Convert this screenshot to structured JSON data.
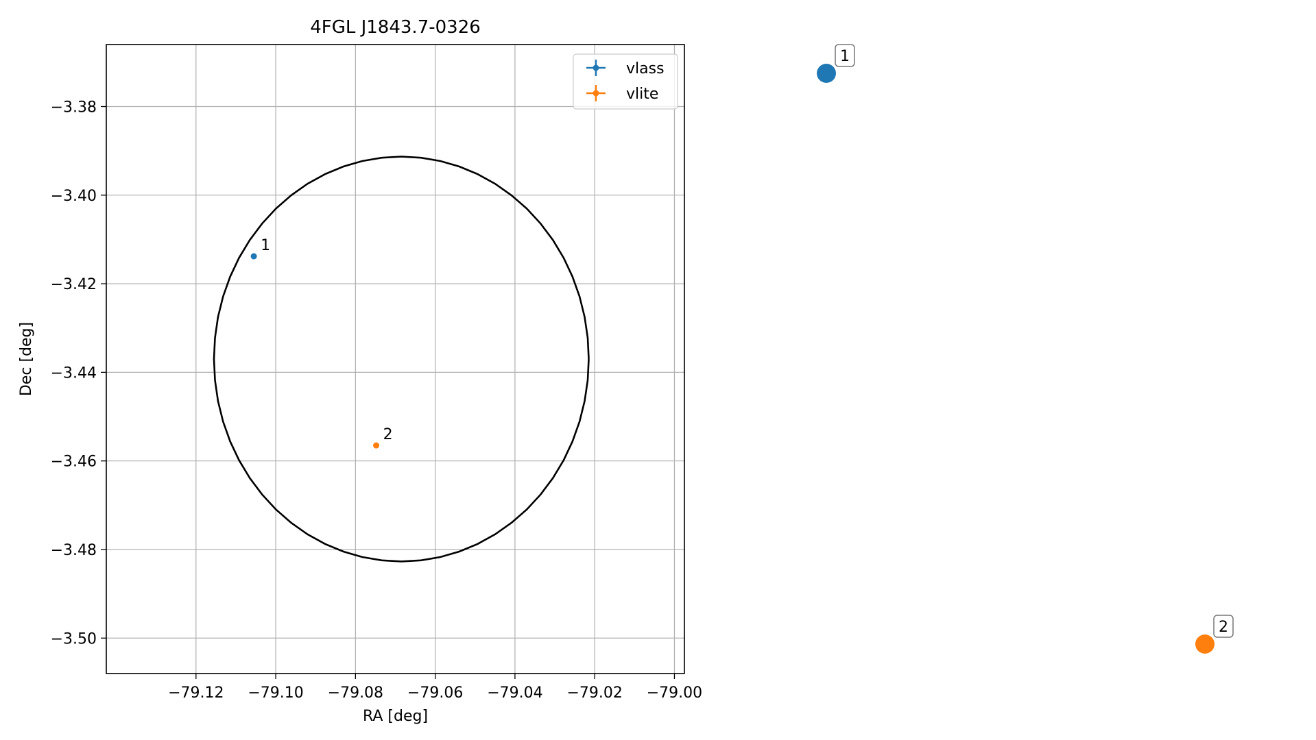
{
  "chart_data": {
    "type": "scatter",
    "title": "4FGL J1843.7-0326",
    "xlabel": "RA [deg]",
    "ylabel": "Dec [deg]",
    "xlim": [
      -79.1425,
      -78.9975
    ],
    "ylim": [
      -3.508,
      -3.366
    ],
    "grid": true,
    "legend_position": "top-right",
    "x_ticks": [
      -79.12,
      -79.1,
      -79.08,
      -79.06,
      -79.04,
      -79.02,
      -79.0
    ],
    "x_tick_labels": [
      "−79.12",
      "−79.10",
      "−79.08",
      "−79.06",
      "−79.04",
      "−79.02",
      "−79.00"
    ],
    "y_ticks": [
      -3.38,
      -3.4,
      -3.42,
      -3.44,
      -3.46,
      -3.48,
      -3.5
    ],
    "y_tick_labels": [
      "−3.38",
      "−3.40",
      "−3.42",
      "−3.44",
      "−3.46",
      "−3.48",
      "−3.50"
    ],
    "series": [
      {
        "name": "vlass",
        "color": "#1f77b4",
        "points": [
          {
            "x": -79.1055,
            "y": -3.4138,
            "label": "1"
          }
        ]
      },
      {
        "name": "vlite",
        "color": "#ff7f0e",
        "points": [
          {
            "x": -79.0748,
            "y": -3.4565,
            "label": "2"
          }
        ]
      }
    ],
    "circle": {
      "center_x": -79.0685,
      "center_y": -3.437,
      "radius_x": 0.047,
      "radius_y": 0.0457,
      "color": "#000000"
    }
  },
  "side_markers": [
    {
      "label": "1",
      "color": "#1f77b4"
    },
    {
      "label": "2",
      "color": "#ff7f0e"
    }
  ]
}
